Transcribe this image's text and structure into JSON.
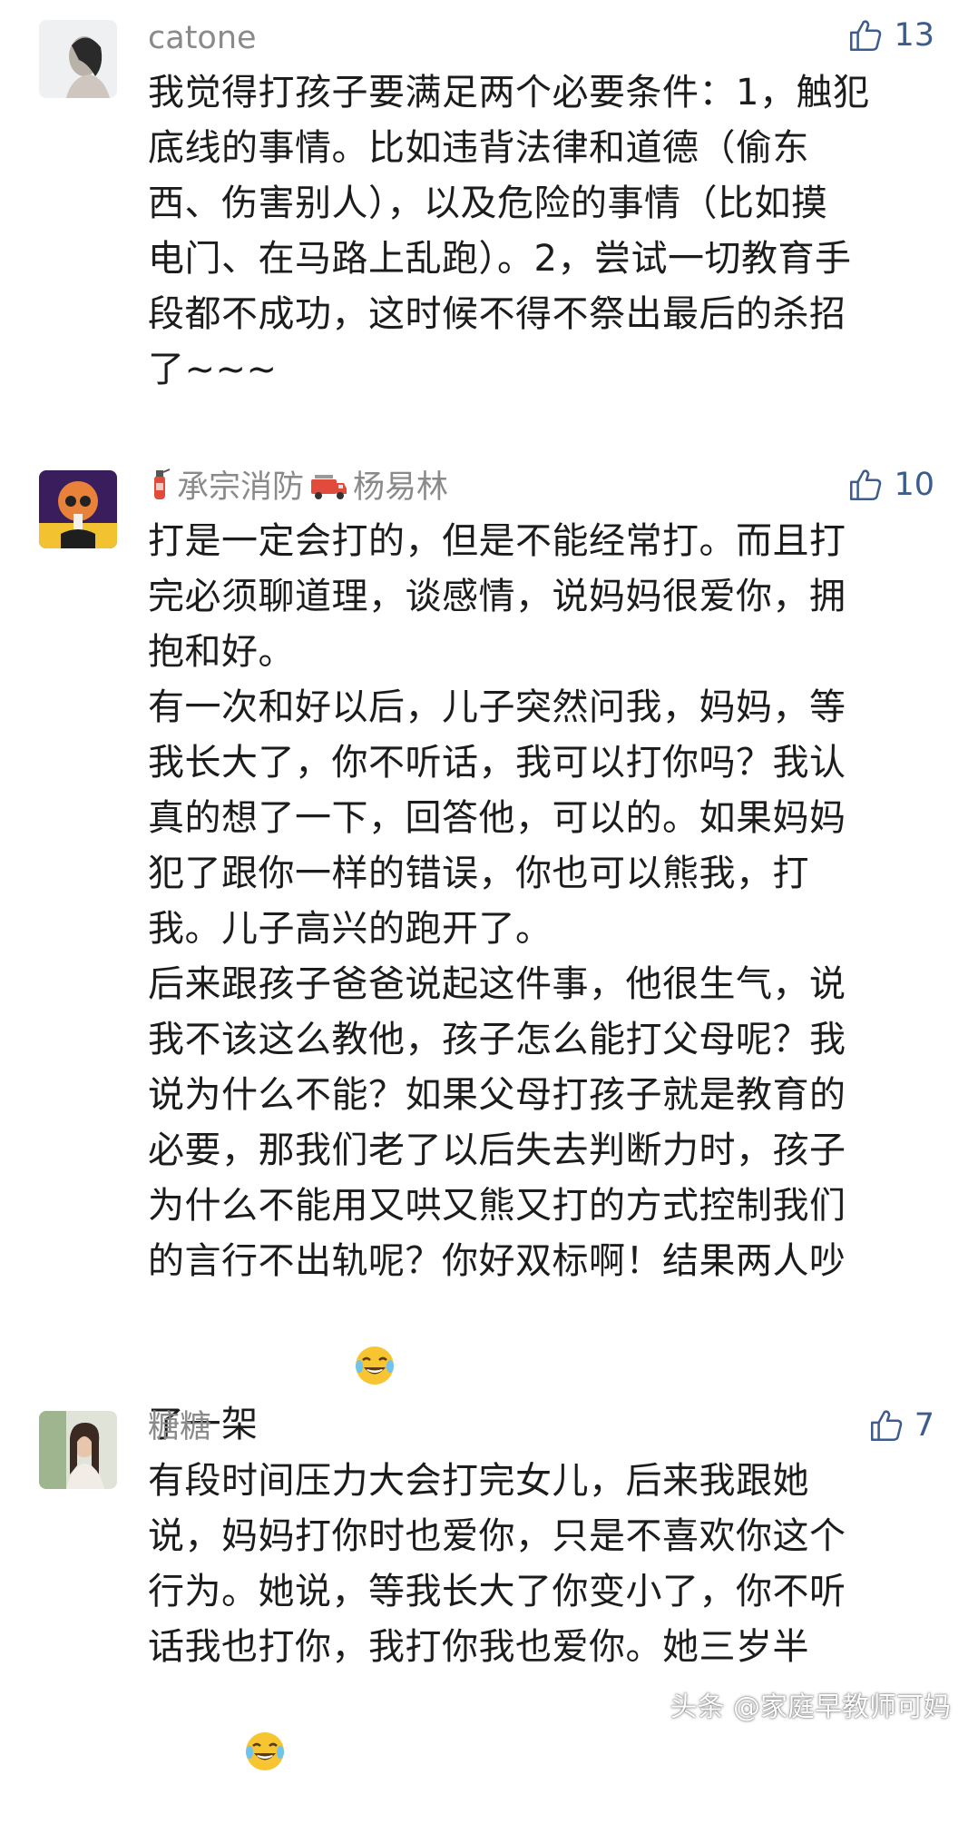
{
  "comments": [
    {
      "username": "catone",
      "likes": "13",
      "lines": [
        "我觉得打孩子要满足两个必要条件：1，触犯",
        "底线的事情。比如违背法律和道德（偷东",
        "西、伤害别人），以及危险的事情（比如摸",
        "电门、在马路上乱跑）。2，尝试一切教育手",
        "段都不成功，这时候不得不祭出最后的杀招",
        "了~~~"
      ]
    },
    {
      "username": "承宗消防",
      "username_suffix": "杨易林",
      "likes": "10",
      "lines": [
        "打是一定会打的，但是不能经常打。而且打",
        "完必须聊道理，谈感情，说妈妈很爱你，拥",
        "抱和好。",
        "有一次和好以后，儿子突然问我，妈妈，等",
        "我长大了，你不听话，我可以打你吗？我认",
        "真的想了一下，回答他，可以的。如果妈妈",
        "犯了跟你一样的错误，你也可以熊我，打",
        "我。儿子高兴的跑开了。",
        "后来跟孩子爸爸说起这件事，他很生气，说",
        "我不该这么教他，孩子怎么能打父母呢？我",
        "说为什么不能？如果父母打孩子就是教育的",
        "必要，那我们老了以后失去判断力时，孩子",
        "为什么不能用又哄又熊又打的方式控制我们",
        "的言行不出轨呢？你好双标啊！结果两人吵",
        "了一架"
      ]
    },
    {
      "username": "糖糖",
      "likes": "7",
      "lines": [
        "有段时间压力大会打完女儿，后来我跟她",
        "说，妈妈打你时也爱你，只是不喜欢你这个",
        "行为。她说，等我长大了你变小了，你不听",
        "话我也打你，我打你我也爱你。她三岁半"
      ]
    }
  ],
  "watermark": "头条 @家庭早教师可妈",
  "icons": {
    "like": "thumbs-up-icon",
    "extinguisher": "fire-extinguisher-icon",
    "firetruck": "fire-truck-icon",
    "laugh": "laughing-tears-emoji"
  },
  "colors": {
    "username": "#8a8a8a",
    "like_count": "#3d5b8c",
    "text": "#1c1c1c"
  }
}
